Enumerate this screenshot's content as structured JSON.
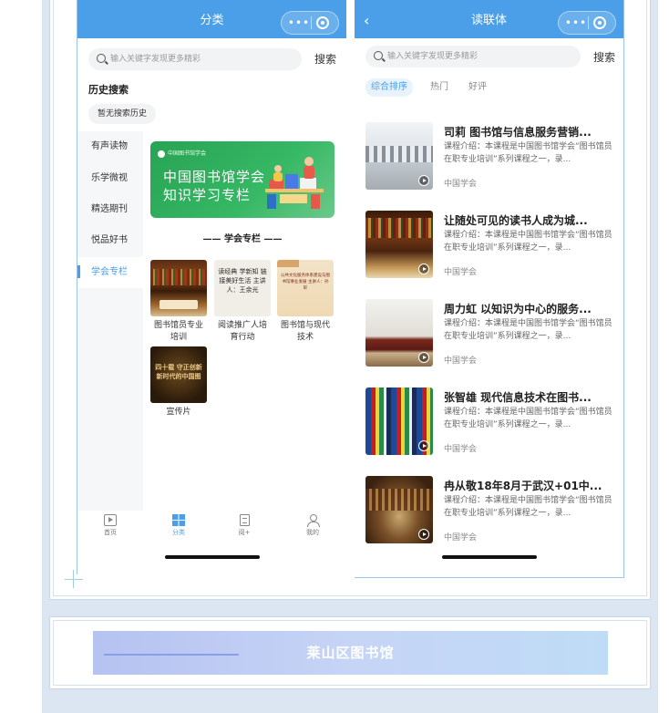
{
  "colors": {
    "accent": "#4a9fe8",
    "navbar": "#4a9fe8",
    "frame": "#dce6f3",
    "banner_green": "#2fae5c"
  },
  "left_screen": {
    "title": "分类",
    "capsule_dots": "•••",
    "search": {
      "placeholder": "输入关键字发现更多精彩",
      "button": "搜索"
    },
    "history": {
      "title": "历史搜索",
      "empty_chip": "暂无搜索历史"
    },
    "side_nav": [
      {
        "label": "有声读物",
        "active": false
      },
      {
        "label": "乐学微视",
        "active": false
      },
      {
        "label": "精选期刊",
        "active": false
      },
      {
        "label": "悦品好书",
        "active": false
      },
      {
        "label": "学会专栏",
        "active": true
      }
    ],
    "banner": {
      "logo_text": "中国图书馆学会",
      "line1": "中国图书馆学会",
      "line2": "知识学习专栏"
    },
    "section_title": "—— 学会专栏 ——",
    "grid": [
      {
        "caption": "图书馆员专业培训",
        "thumb": "bookshelf"
      },
      {
        "caption": "阅读推广人培育行动",
        "thumb": "calligraphy",
        "thumb_text": "读经典 学新知 链接美好生活 主讲人：王余光"
      },
      {
        "caption": "图书馆与现代技术",
        "thumb": "paper",
        "thumb_text": "公共文化服务体系建设与图书馆事业发展 主讲人：孙轩"
      },
      {
        "caption": "宣传片",
        "thumb": "dark",
        "thumb_text": "四十载 守正创新 新时代的中国图"
      }
    ],
    "tabbar": [
      {
        "label": "首页",
        "icon": "play-icon",
        "active": false
      },
      {
        "label": "分类",
        "icon": "grid-icon",
        "active": true
      },
      {
        "label": "阅+",
        "icon": "book-icon",
        "active": false
      },
      {
        "label": "我的",
        "icon": "user-icon",
        "active": false
      }
    ]
  },
  "right_screen": {
    "title": "读联体",
    "back_glyph": "‹",
    "capsule_dots": "•••",
    "search": {
      "placeholder": "输入关键字发现更多精彩",
      "button": "搜索"
    },
    "filters": [
      {
        "label": "综合排序",
        "active": true
      },
      {
        "label": "热门",
        "active": false
      },
      {
        "label": "好评",
        "active": false
      }
    ],
    "courses": [
      {
        "title": "司莉 图书馆与信息服务营销...",
        "desc": "课程介绍：本课程是中国图书馆学会“图书馆员在职专业培训”系列课程之一，录...",
        "author": "中国学会",
        "image": "library-interior"
      },
      {
        "title": "让随处可见的读书人成为城...",
        "desc": "课程介绍：本课程是中国图书馆学会“图书馆员在职专业培训”系列课程之一，录...",
        "author": "中国学会",
        "image": "bookshelf"
      },
      {
        "title": "周力虹 以知识为中心的服务...",
        "desc": "课程介绍：本课程是中国图书馆学会“图书馆员在职专业培训”系列课程之一，录...",
        "author": "中国学会",
        "image": "book-stack"
      },
      {
        "title": "张智雄 现代信息技术在图书...",
        "desc": "课程介绍：本课程是中国图书馆学会“图书馆员在职专业培训”系列课程之一，录...",
        "author": "中国学会",
        "image": "colorful-spines"
      },
      {
        "title": "冉从敬18年8月于武汉+01中...",
        "desc": "课程介绍：本课程是中国图书馆学会“图书馆员在职专业培训”系列课程之一，录...",
        "author": "中国学会",
        "image": "library-hall"
      }
    ]
  },
  "footer": {
    "library_name": "莱山区图书馆"
  }
}
